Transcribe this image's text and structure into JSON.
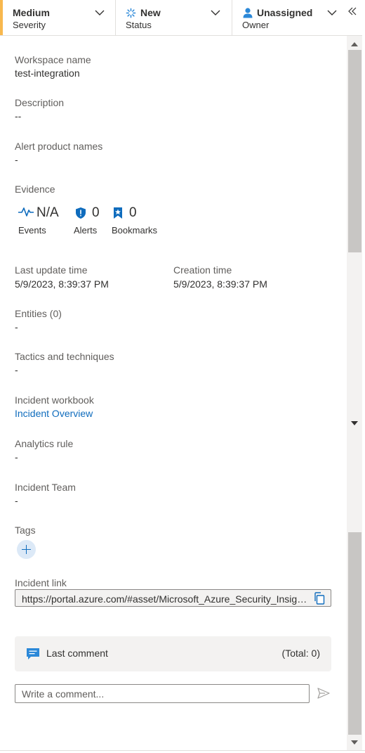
{
  "header": {
    "severity": {
      "value": "Medium",
      "label": "Severity",
      "accent_color": "#f8b84e"
    },
    "status": {
      "value": "New",
      "label": "Status",
      "icon": "new-status-icon"
    },
    "owner": {
      "value": "Unassigned",
      "label": "Owner",
      "icon": "person-icon"
    },
    "collapse_icon": "double-chevron-left-icon"
  },
  "fields": {
    "workspace": {
      "label": "Workspace name",
      "value": "test-integration"
    },
    "description": {
      "label": "Description",
      "value": "--"
    },
    "alert_products": {
      "label": "Alert product names",
      "value": "-"
    },
    "evidence": {
      "label": "Evidence",
      "events": {
        "value": "N/A",
        "label": "Events",
        "icon": "pulse-icon"
      },
      "alerts": {
        "value": "0",
        "label": "Alerts",
        "icon": "shield-icon"
      },
      "bookmarks": {
        "value": "0",
        "label": "Bookmarks",
        "icon": "bookmark-icon"
      }
    },
    "last_update": {
      "label": "Last update time",
      "value": "5/9/2023, 8:39:37 PM"
    },
    "creation": {
      "label": "Creation time",
      "value": "5/9/2023, 8:39:37 PM"
    },
    "entities": {
      "label": "Entities (0)",
      "value": "-"
    },
    "tactics": {
      "label": "Tactics and techniques",
      "value": "-"
    },
    "workbook": {
      "label": "Incident workbook",
      "value": "Incident Overview"
    },
    "analytics_rule": {
      "label": "Analytics rule",
      "value": "-"
    },
    "team": {
      "label": "Incident Team",
      "value": "-"
    },
    "tags": {
      "label": "Tags"
    },
    "incident_link": {
      "label": "Incident link",
      "value": "https://portal.azure.com/#asset/Microsoft_Azure_Security_Insights/Incident"
    }
  },
  "comments": {
    "title": "Last comment",
    "total": "(Total: 0)",
    "placeholder": "Write a comment..."
  },
  "colors": {
    "link": "#0f6cbd",
    "icon_blue": "#0f6cbd"
  }
}
